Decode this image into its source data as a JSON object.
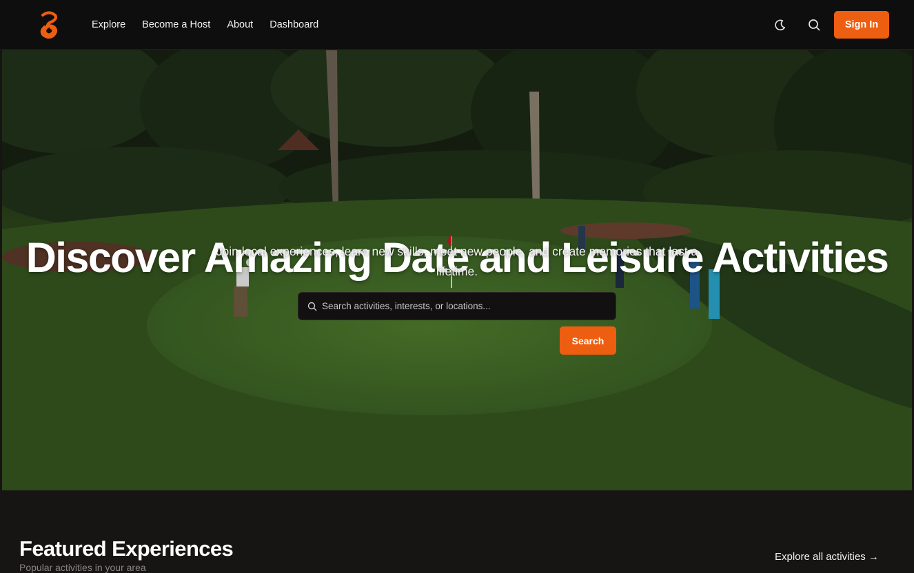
{
  "nav": {
    "logo_icon": "logo-g-icon",
    "links": [
      "Explore",
      "Become a Host",
      "About",
      "Dashboard"
    ],
    "theme_icon": "moon-icon",
    "search_icon": "search-icon",
    "signin_label": "Sign In"
  },
  "hero": {
    "title": "Discover Amazing Date and Leisure Activities",
    "subtitle": "Join local experiences, learn new skills, meet new people, and create memories that last a lifetime.",
    "search_placeholder": "Search activities, interests, or locations...",
    "search_icon": "search-icon",
    "search_button": "Search",
    "image_icon": "golf-course-photo"
  },
  "featured": {
    "title": "Featured Experiences",
    "subtitle": "Popular activities in your area",
    "explore_all": "Explore all activities →"
  },
  "colors": {
    "accent": "#ee5e11",
    "nav_bg": "#0f0e0e",
    "page_bg": "#171414"
  }
}
